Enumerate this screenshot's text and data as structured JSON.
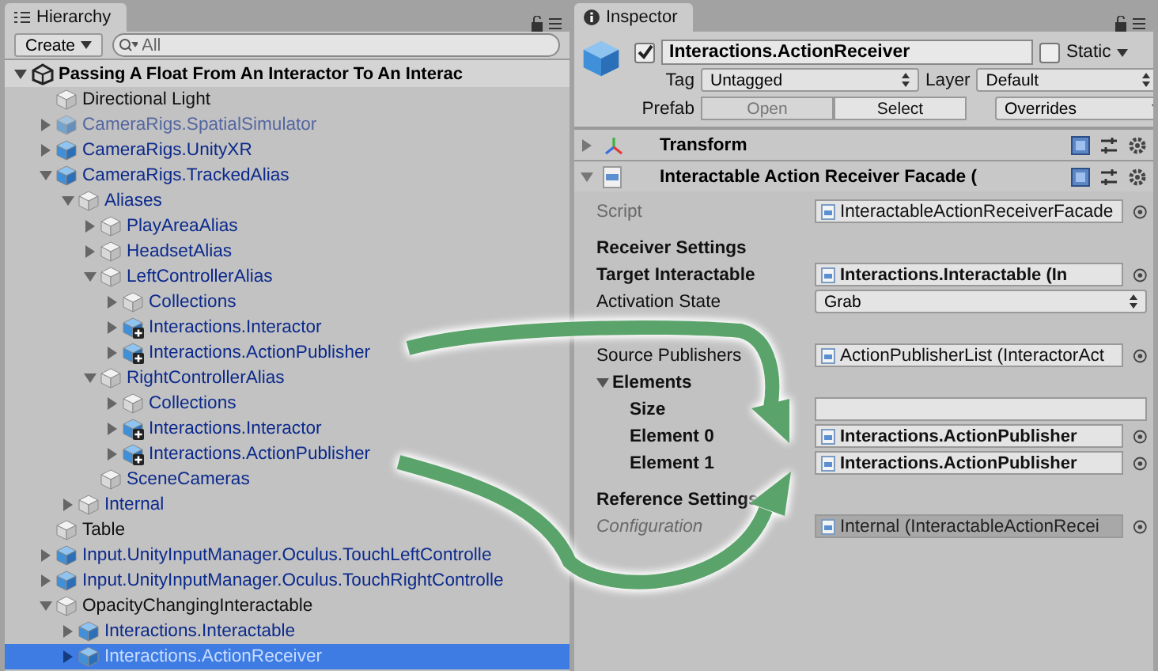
{
  "hierarchy": {
    "tab": "Hierarchy",
    "create_button": "Create",
    "search": {
      "placeholder": "All"
    },
    "scene": {
      "title": "Passing A Float From An Interactor To An Interac",
      "expanded": true
    },
    "items": [
      {
        "name": "Directional Light",
        "kind": "object",
        "prefab": false,
        "selected": false
      },
      {
        "name": "CameraRigs.SpatialSimulator",
        "kind": "prefab",
        "prefab": true,
        "disabled": true,
        "expanded": false,
        "selected": false
      },
      {
        "name": "CameraRigs.UnityXR",
        "kind": "prefab",
        "prefab": true,
        "expanded": false,
        "selected": false
      },
      {
        "name": "CameraRigs.TrackedAlias",
        "kind": "prefab",
        "prefab": true,
        "expanded": true,
        "selected": false,
        "children": [
          {
            "name": "Aliases",
            "kind": "object",
            "prefab": true,
            "expanded": true,
            "selected": false,
            "children": [
              {
                "name": "PlayAreaAlias",
                "kind": "object",
                "prefab": true,
                "expanded": false,
                "selected": false
              },
              {
                "name": "HeadsetAlias",
                "kind": "object",
                "prefab": true,
                "expanded": false,
                "selected": false
              },
              {
                "name": "LeftControllerAlias",
                "kind": "object",
                "prefab": true,
                "expanded": true,
                "selected": false,
                "children": [
                  {
                    "name": "Collections",
                    "kind": "object",
                    "prefab": true,
                    "expanded": false,
                    "selected": false
                  },
                  {
                    "name": "Interactions.Interactor",
                    "kind": "added",
                    "prefab": true,
                    "expanded": false,
                    "selected": false
                  },
                  {
                    "name": "Interactions.ActionPublisher",
                    "kind": "added",
                    "prefab": true,
                    "expanded": false,
                    "selected": false
                  }
                ]
              },
              {
                "name": "RightControllerAlias",
                "kind": "object",
                "prefab": true,
                "expanded": true,
                "selected": false,
                "children": [
                  {
                    "name": "Collections",
                    "kind": "object",
                    "prefab": true,
                    "expanded": false,
                    "selected": false
                  },
                  {
                    "name": "Interactions.Interactor",
                    "kind": "added",
                    "prefab": true,
                    "expanded": false,
                    "selected": false
                  },
                  {
                    "name": "Interactions.ActionPublisher",
                    "kind": "added",
                    "prefab": true,
                    "expanded": false,
                    "selected": false
                  }
                ]
              },
              {
                "name": "SceneCameras",
                "kind": "object",
                "prefab": true,
                "selected": false
              }
            ]
          },
          {
            "name": "Internal",
            "kind": "object",
            "prefab": true,
            "expanded": false,
            "selected": false
          }
        ]
      },
      {
        "name": "Table",
        "kind": "object",
        "prefab": false,
        "selected": false
      },
      {
        "name": "Input.UnityInputManager.Oculus.TouchLeftControlle",
        "kind": "prefab",
        "prefab": true,
        "expanded": false,
        "selected": false
      },
      {
        "name": "Input.UnityInputManager.Oculus.TouchRightControlle",
        "kind": "prefab",
        "prefab": true,
        "expanded": false,
        "selected": false
      },
      {
        "name": "OpacityChangingInteractable",
        "kind": "object",
        "prefab": false,
        "expanded": true,
        "selected": false,
        "children": [
          {
            "name": "Interactions.Interactable",
            "kind": "prefab",
            "prefab": true,
            "expanded": false,
            "selected": false
          },
          {
            "name": "Interactions.ActionReceiver",
            "kind": "prefab",
            "prefab": true,
            "expanded": false,
            "selected": true
          }
        ]
      }
    ]
  },
  "inspector": {
    "tab": "Inspector",
    "object": {
      "active": true,
      "name": "Interactions.ActionReceiver",
      "static_label": "Static",
      "static": false,
      "tag_label": "Tag",
      "tag": "Untagged",
      "layer_label": "Layer",
      "layer": "Default",
      "prefab_label": "Prefab",
      "open_button": "Open",
      "select_button": "Select",
      "overrides": "Overrides"
    },
    "components": [
      {
        "title": "Transform",
        "kind": "transform",
        "expanded": false
      },
      {
        "title": "Interactable Action Receiver Facade (",
        "kind": "script",
        "expanded": true
      }
    ],
    "fields": [
      {
        "kind": "object",
        "label": "Script",
        "value": "InteractableActionReceiverFacade",
        "disabled": true
      },
      {
        "kind": "heading",
        "label": "Receiver Settings"
      },
      {
        "kind": "object",
        "label": "Target Interactable",
        "value": "Interactions.Interactable (In",
        "overridden": true
      },
      {
        "kind": "dropdown",
        "label": "Activation State",
        "value": "Grab"
      },
      {
        "kind": "space"
      },
      {
        "kind": "object",
        "label": "Source Publishers",
        "value": "ActionPublisherList (InteractorAct"
      },
      {
        "kind": "foldout",
        "label": "Elements",
        "expanded": true,
        "children": [
          {
            "kind": "text",
            "label": "Size",
            "overridden": true
          },
          {
            "kind": "object",
            "label": "Element 0",
            "value": "Interactions.ActionPublisher",
            "overridden": true
          },
          {
            "kind": "object",
            "label": "Element 1",
            "value": "Interactions.ActionPublisher",
            "overridden": true
          }
        ]
      },
      {
        "kind": "heading",
        "label": "Reference Settings"
      },
      {
        "kind": "object",
        "label": "Configuration",
        "value": "Internal (InteractableActionRecei",
        "disabled": true,
        "italic": true
      }
    ]
  }
}
